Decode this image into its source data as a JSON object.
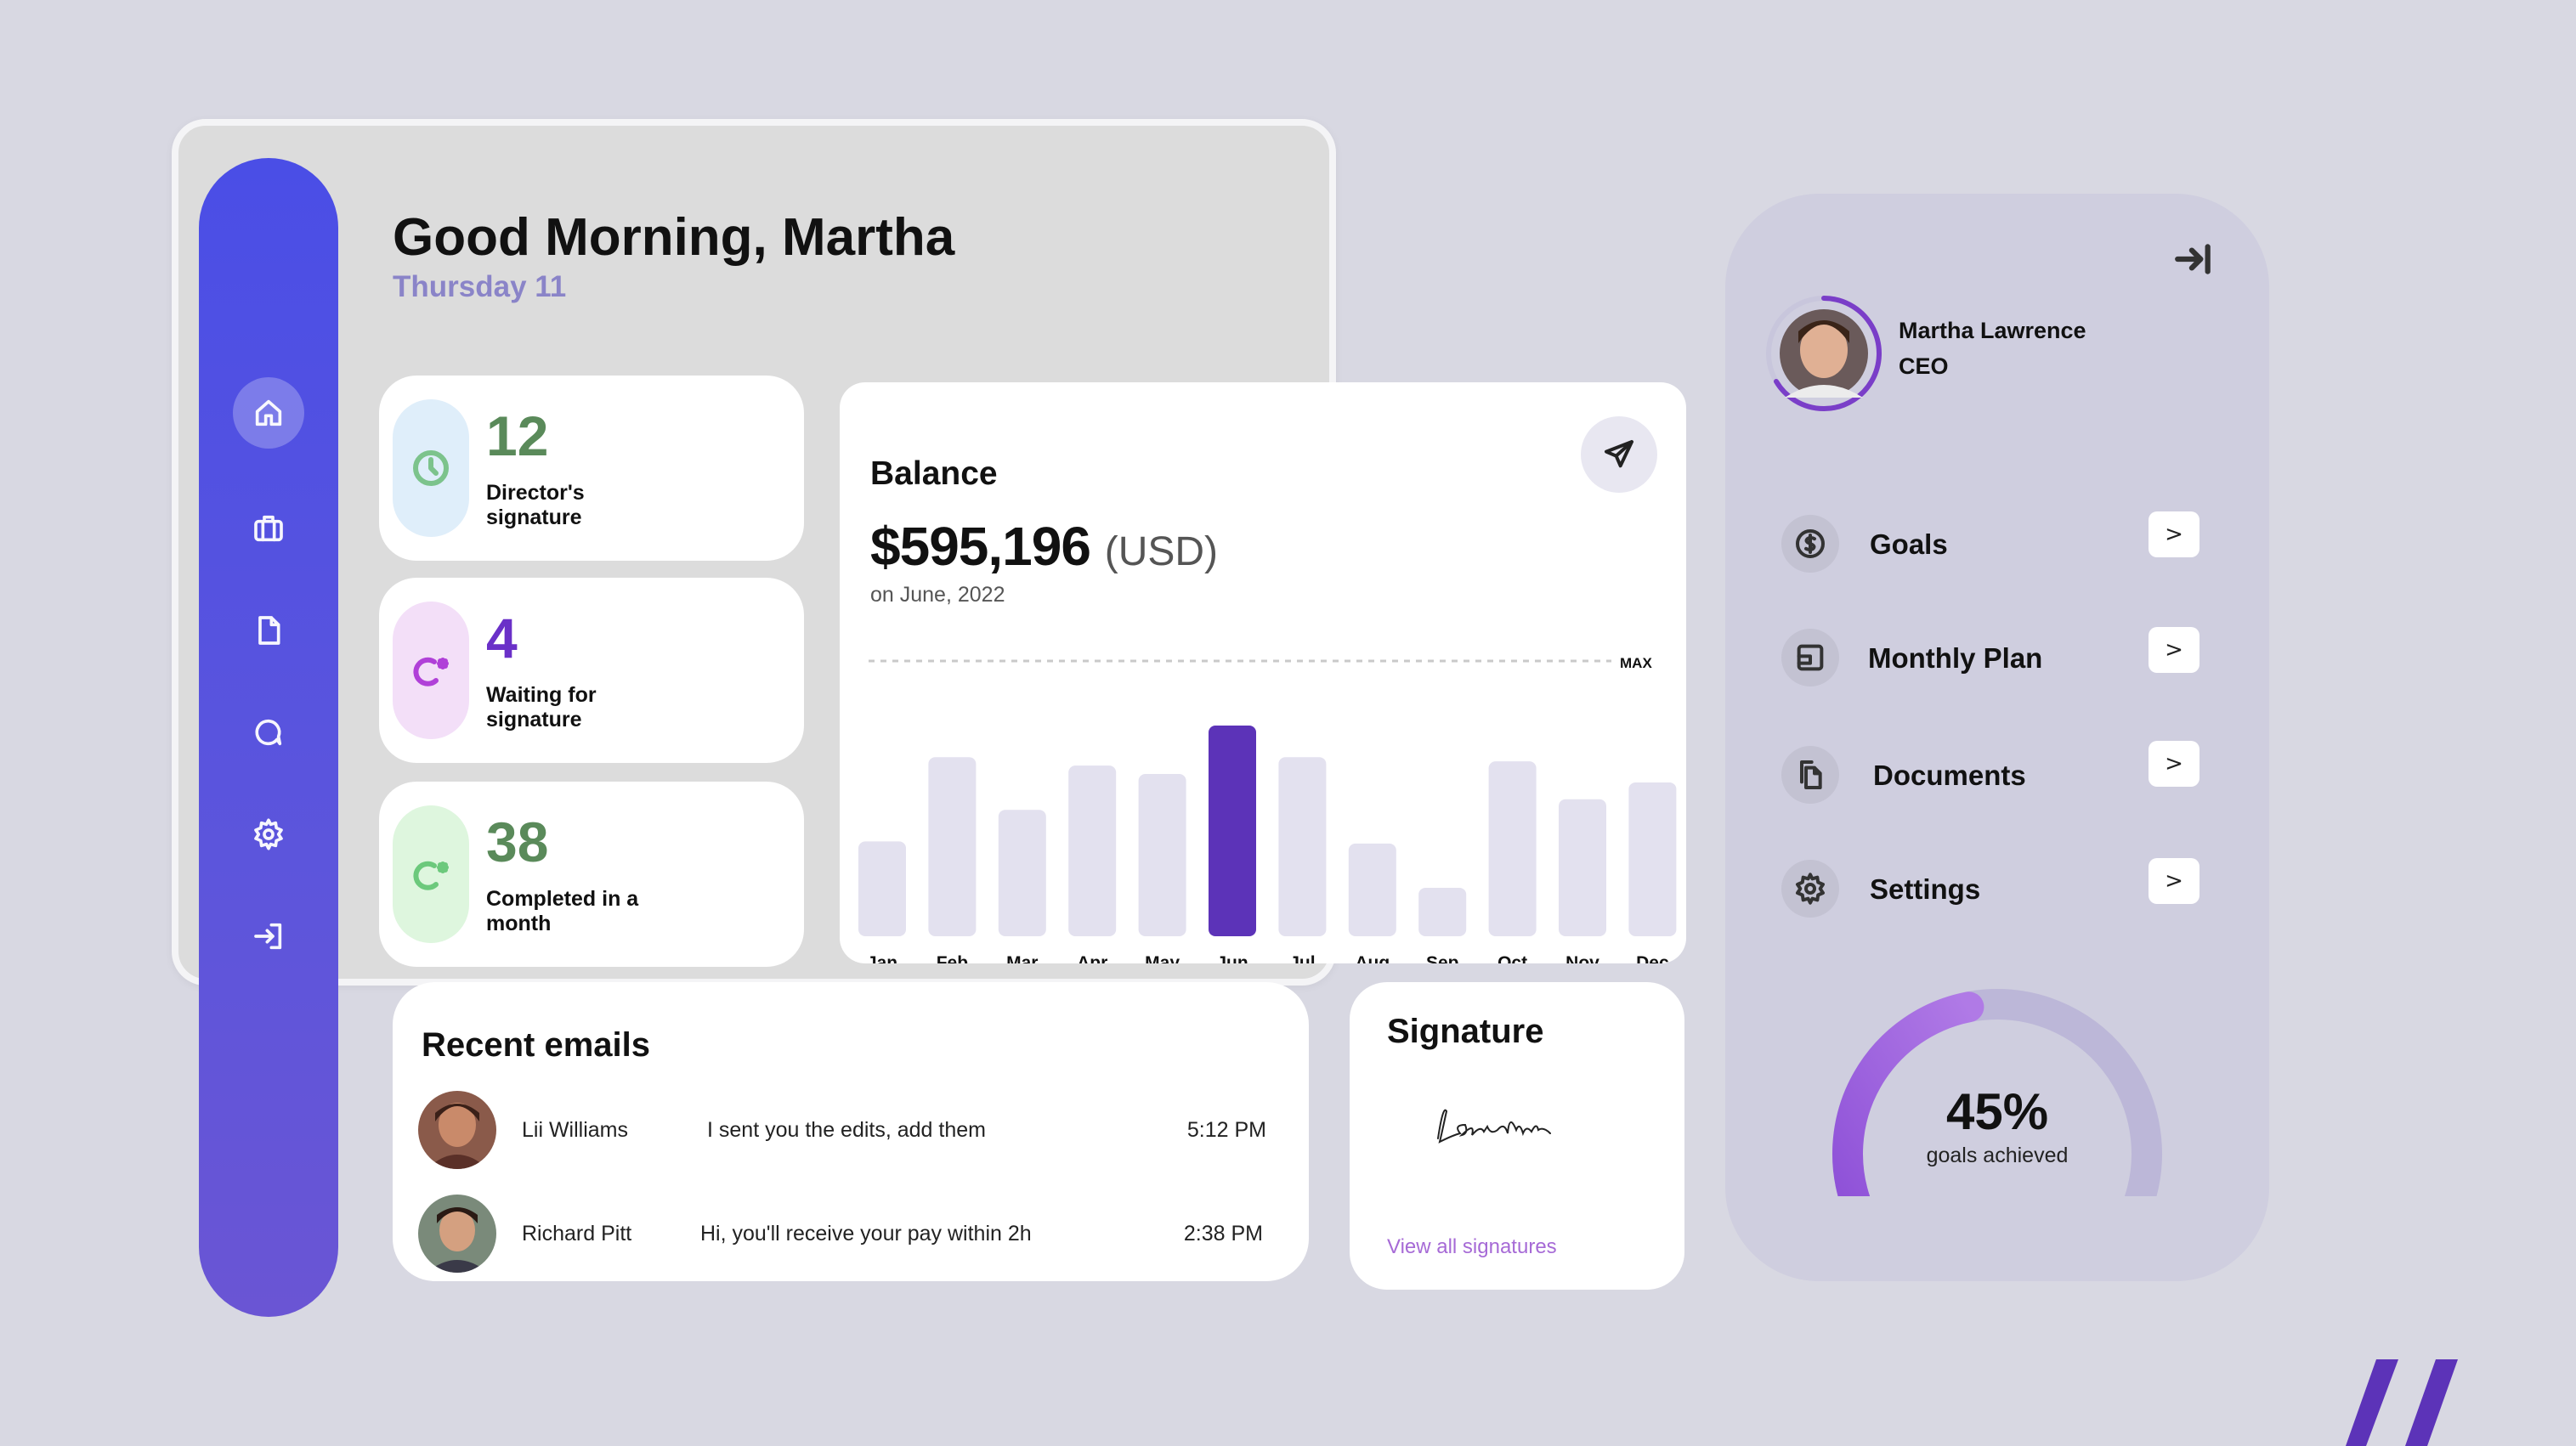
{
  "header": {
    "greeting": "Good Morning, Martha",
    "date": "Thursday 11"
  },
  "sidebar": {
    "items": [
      {
        "icon": "home-icon"
      },
      {
        "icon": "briefcase-icon"
      },
      {
        "icon": "file-icon"
      },
      {
        "icon": "chat-icon"
      },
      {
        "icon": "gear-icon"
      },
      {
        "icon": "login-icon"
      }
    ]
  },
  "stats": [
    {
      "value": "12",
      "label": "Director's signature",
      "icon": "clock-icon",
      "color": "#5a8a5a",
      "pill": "#dfeefa"
    },
    {
      "value": "4",
      "label": "Waiting for signature",
      "icon": "sign-pending-icon",
      "color": "#6a30c8",
      "pill": "#f3dff8"
    },
    {
      "value": "38",
      "label": "Completed in a month",
      "icon": "sign-done-icon",
      "color": "#5a8a5a",
      "pill": "#def6de"
    }
  ],
  "balance": {
    "title": "Balance",
    "amount": "$595,196",
    "unit": "(USD)",
    "date": "on June, 2022",
    "max_label": "MAX"
  },
  "chart_data": {
    "type": "bar",
    "categories": [
      "Jan",
      "Feb",
      "Mar",
      "Apr",
      "May",
      "Jun",
      "Jul",
      "Aug",
      "Sep",
      "Oct",
      "Nov",
      "Dec"
    ],
    "values": [
      45,
      85,
      60,
      81,
      77,
      100,
      85,
      44,
      23,
      83,
      65,
      73
    ],
    "highlight": "Jun",
    "bar_color": "#e3e1ef",
    "highlight_color": "#5c33b8",
    "ylim": [
      0,
      100
    ]
  },
  "emails": {
    "title": "Recent emails",
    "rows": [
      {
        "name": "Lii Williams",
        "message": "I sent you the edits, add them",
        "time": "5:12 PM"
      },
      {
        "name": "Richard Pitt",
        "message": "Hi, you'll receive your pay within 2h",
        "time": "2:38 PM"
      }
    ]
  },
  "signature": {
    "title": "Signature",
    "signature_text": "Laver Mike",
    "link": "View all signatures"
  },
  "profile": {
    "name": "Martha Lawrence",
    "role": "CEO",
    "menu": [
      {
        "label": "Goals",
        "icon": "dollar-icon",
        "arrow": ">"
      },
      {
        "label": "Monthly Plan",
        "icon": "plan-icon",
        "arrow": ">"
      },
      {
        "label": "Documents",
        "icon": "documents-icon",
        "arrow": ">"
      },
      {
        "label": "Settings",
        "icon": "gear-icon",
        "arrow": ">"
      }
    ],
    "goal_percent": 45,
    "goal_text": "45%",
    "goal_label": "goals achieved"
  }
}
